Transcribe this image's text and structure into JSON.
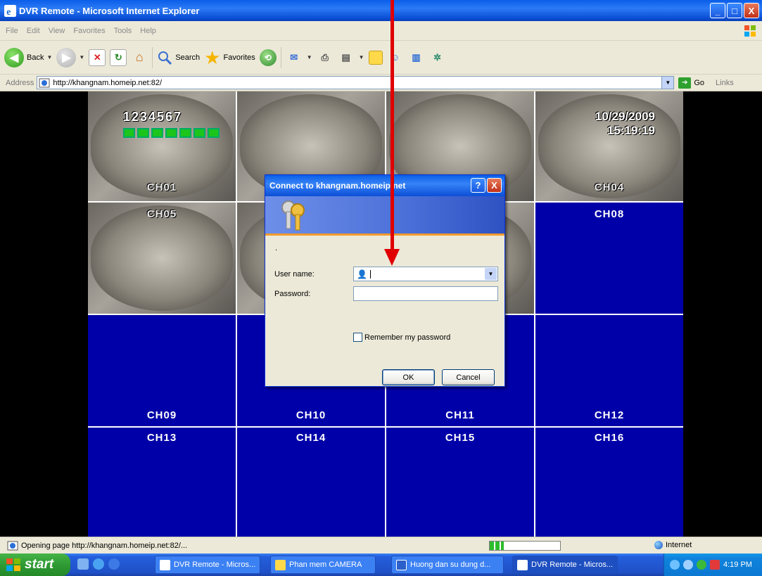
{
  "window": {
    "title": "DVR Remote - Microsoft Internet Explorer",
    "min": "_",
    "max": "□",
    "close": "X"
  },
  "menu": [
    "File",
    "Edit",
    "View",
    "Favorites",
    "Tools",
    "Help"
  ],
  "toolbar": {
    "back_label": "Back",
    "search_label": "Search",
    "favorites_label": "Favorites"
  },
  "address": {
    "label": "Address",
    "url": "http://khangnam.homeip.net:82/",
    "go_label": "Go",
    "links_label": "Links"
  },
  "grid": {
    "channels": [
      "CH01",
      "",
      "",
      "CH04",
      "CH05",
      "",
      "",
      "CH08",
      "CH09",
      "CH10",
      "CH11",
      "CH12",
      "CH13",
      "CH14",
      "CH15",
      "CH16"
    ],
    "osd_numbers": "1234567",
    "osd_date": "10/29/2009",
    "osd_time": "15:19:19"
  },
  "dialog": {
    "title": "Connect to khangnam.homeip.net",
    "help_btn": "?",
    "close_btn": "X",
    "dot": ".",
    "username_label": "User name:",
    "username_value": "",
    "password_label": "Password:",
    "remember_label": "Remember my password",
    "ok_label": "OK",
    "cancel_label": "Cancel"
  },
  "status": {
    "text": "Opening page http://khangnam.homeip.net:82/...",
    "zone": "Internet",
    "progress": 0.2
  },
  "taskbar": {
    "start_label": "start",
    "tasks": [
      "DVR Remote - Micros...",
      "Phan mem CAMERA",
      "Huong dan su dung d...",
      "DVR Remote - Micros..."
    ],
    "clock": "4:19 PM"
  },
  "colors": {
    "channel_bg": "#0000a8",
    "annotation_arrow": "#e00000",
    "xp_blue": "#0a5ee8"
  }
}
